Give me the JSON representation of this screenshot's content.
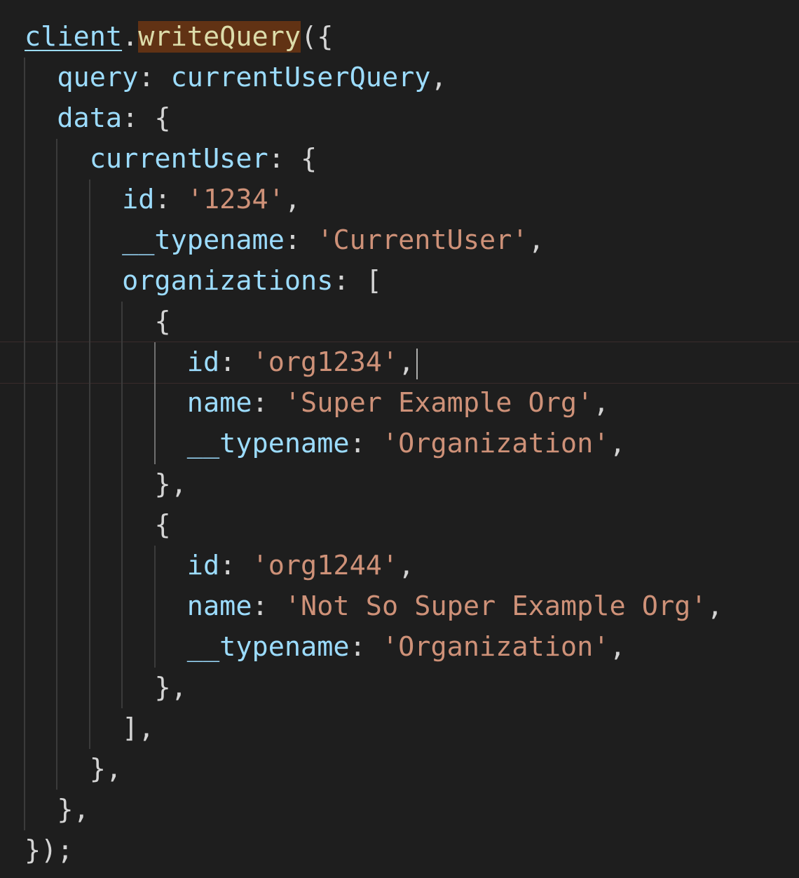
{
  "editor": {
    "theme": "dark",
    "colors": {
      "background": "#1e1e1e",
      "property": "#9cdcfe",
      "string": "#ce9178",
      "function": "#dcdcaa",
      "punctuation": "#d4d4d4",
      "function_highlight": "#613214"
    },
    "lines": [
      {
        "tokens": [
          {
            "t": "obj",
            "v": "client"
          },
          {
            "t": "pun",
            "v": "."
          },
          {
            "t": "fn",
            "v": "writeQuery"
          },
          {
            "t": "pun",
            "v": "({"
          }
        ]
      },
      {
        "tokens": [
          {
            "t": "ws",
            "v": "  "
          },
          {
            "t": "prop",
            "v": "query"
          },
          {
            "t": "pun",
            "v": ": "
          },
          {
            "t": "var",
            "v": "currentUserQuery"
          },
          {
            "t": "pun",
            "v": ","
          }
        ]
      },
      {
        "tokens": [
          {
            "t": "ws",
            "v": "  "
          },
          {
            "t": "prop",
            "v": "data"
          },
          {
            "t": "pun",
            "v": ": {"
          }
        ]
      },
      {
        "tokens": [
          {
            "t": "ws",
            "v": "    "
          },
          {
            "t": "prop",
            "v": "currentUser"
          },
          {
            "t": "pun",
            "v": ": {"
          }
        ]
      },
      {
        "tokens": [
          {
            "t": "ws",
            "v": "      "
          },
          {
            "t": "prop",
            "v": "id"
          },
          {
            "t": "pun",
            "v": ": "
          },
          {
            "t": "str",
            "v": "'1234'"
          },
          {
            "t": "pun",
            "v": ","
          }
        ]
      },
      {
        "tokens": [
          {
            "t": "ws",
            "v": "      "
          },
          {
            "t": "prop",
            "v": "__typename"
          },
          {
            "t": "pun",
            "v": ": "
          },
          {
            "t": "str",
            "v": "'CurrentUser'"
          },
          {
            "t": "pun",
            "v": ","
          }
        ]
      },
      {
        "tokens": [
          {
            "t": "ws",
            "v": "      "
          },
          {
            "t": "prop",
            "v": "organizations"
          },
          {
            "t": "pun",
            "v": ": ["
          }
        ]
      },
      {
        "tokens": [
          {
            "t": "ws",
            "v": "        "
          },
          {
            "t": "pun",
            "v": "{"
          }
        ]
      },
      {
        "current": true,
        "tokens": [
          {
            "t": "ws",
            "v": "          "
          },
          {
            "t": "prop",
            "v": "id"
          },
          {
            "t": "pun",
            "v": ": "
          },
          {
            "t": "str",
            "v": "'org1234'"
          },
          {
            "t": "pun",
            "v": ","
          },
          {
            "t": "caret",
            "v": ""
          }
        ]
      },
      {
        "tokens": [
          {
            "t": "ws",
            "v": "          "
          },
          {
            "t": "prop",
            "v": "name"
          },
          {
            "t": "pun",
            "v": ": "
          },
          {
            "t": "str",
            "v": "'Super Example Org'"
          },
          {
            "t": "pun",
            "v": ","
          }
        ]
      },
      {
        "tokens": [
          {
            "t": "ws",
            "v": "          "
          },
          {
            "t": "prop",
            "v": "__typename"
          },
          {
            "t": "pun",
            "v": ": "
          },
          {
            "t": "str",
            "v": "'Organization'"
          },
          {
            "t": "pun",
            "v": ","
          }
        ]
      },
      {
        "tokens": [
          {
            "t": "ws",
            "v": "        "
          },
          {
            "t": "pun",
            "v": "},"
          }
        ]
      },
      {
        "tokens": [
          {
            "t": "ws",
            "v": "        "
          },
          {
            "t": "pun",
            "v": "{"
          }
        ]
      },
      {
        "tokens": [
          {
            "t": "ws",
            "v": "          "
          },
          {
            "t": "prop",
            "v": "id"
          },
          {
            "t": "pun",
            "v": ": "
          },
          {
            "t": "str",
            "v": "'org1244'"
          },
          {
            "t": "pun",
            "v": ","
          }
        ]
      },
      {
        "tokens": [
          {
            "t": "ws",
            "v": "          "
          },
          {
            "t": "prop",
            "v": "name"
          },
          {
            "t": "pun",
            "v": ": "
          },
          {
            "t": "str",
            "v": "'Not So Super Example Org'"
          },
          {
            "t": "pun",
            "v": ","
          }
        ]
      },
      {
        "tokens": [
          {
            "t": "ws",
            "v": "          "
          },
          {
            "t": "prop",
            "v": "__typename"
          },
          {
            "t": "pun",
            "v": ": "
          },
          {
            "t": "str",
            "v": "'Organization'"
          },
          {
            "t": "pun",
            "v": ","
          }
        ]
      },
      {
        "tokens": [
          {
            "t": "ws",
            "v": "        "
          },
          {
            "t": "pun",
            "v": "},"
          }
        ]
      },
      {
        "tokens": [
          {
            "t": "ws",
            "v": "      "
          },
          {
            "t": "pun",
            "v": "],"
          }
        ]
      },
      {
        "tokens": [
          {
            "t": "ws",
            "v": "    "
          },
          {
            "t": "pun",
            "v": "},"
          }
        ]
      },
      {
        "tokens": [
          {
            "t": "ws",
            "v": "  "
          },
          {
            "t": "pun",
            "v": "},"
          }
        ]
      },
      {
        "tokens": [
          {
            "t": "pun",
            "v": "});"
          }
        ]
      }
    ]
  }
}
